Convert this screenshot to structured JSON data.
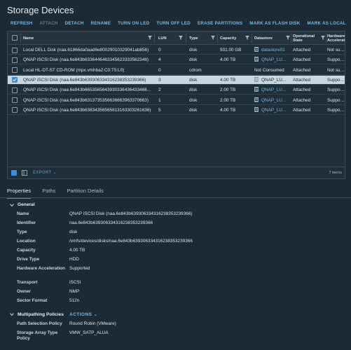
{
  "page": {
    "title": "Storage Devices"
  },
  "toolbar": {
    "refresh": "REFRESH",
    "attach": "ATTACH",
    "detach": "DETACH",
    "rename": "RENAME",
    "turn_on_led": "TURN ON LED",
    "turn_off_led": "TURN OFF LED",
    "erase_partitions": "ERASE PARTITIONS",
    "mark_flash": "MARK AS FLASH DISK",
    "mark_local": "MARK AS LOCAL",
    "more": "···"
  },
  "grid": {
    "columns": {
      "name": "Name",
      "lun": "LUN",
      "type": "Type",
      "capacity": "Capacity",
      "datastore": "Datastore",
      "operational_state": "Operational State",
      "hardware_acceleration": "Hardware Acceleration"
    },
    "rows": [
      {
        "name": "Local DELL Disk (naa.61866da0aad6e80029010329041ab856)",
        "lun": "0",
        "type": "disk",
        "capacity": "931.00 GB",
        "datastore": "datastore01",
        "ds_link": true,
        "state": "Attached",
        "hw": "Not suppor"
      },
      {
        "name": "QNAP iSCSI Disk (naa.6e843b6336446463345623333562346)",
        "lun": "4",
        "type": "disk",
        "capacity": "4.00 TB",
        "datastore": "QNAP_LU...",
        "ds_link": true,
        "state": "Attached",
        "hw": "Supported"
      },
      {
        "name": "Local HL-DT-ST CD-ROM (mpx.vmhba2:C0:T5:L0)",
        "lun": "0",
        "type": "cdrom",
        "capacity": "",
        "datastore": "Not Consumed",
        "ds_link": false,
        "state": "Attached",
        "hw": "Not suppor"
      },
      {
        "name": "QNAP iSCSI Disk (naa.6e843b639306334316238353239366)",
        "lun": "3",
        "type": "disk",
        "capacity": "4.00 TB",
        "datastore": "QNAP_LU...",
        "ds_link": true,
        "state": "Attached",
        "hw": "Supported",
        "selected": true
      },
      {
        "name": "QNAP iSCSI Disk (naa.6e843b6653565643930336436433466...",
        "lun": "2",
        "type": "disk",
        "capacity": "2.00 TB",
        "datastore": "QNAP_LU...",
        "ds_link": true,
        "state": "Attached",
        "hw": "Supported"
      },
      {
        "name": "QNAP iSCSI Disk (naa.6e843b6313735356636663963370663)",
        "lun": "1",
        "type": "disk",
        "capacity": "2.00 TB",
        "datastore": "QNAP_LU...",
        "ds_link": true,
        "state": "Attached",
        "hw": "Supported"
      },
      {
        "name": "QNAP iSCSI Disk (naa.6e843b63834356565613163303261636)",
        "lun": "5",
        "type": "disk",
        "capacity": "4.00 TB",
        "datastore": "QNAP_LU...",
        "ds_link": true,
        "state": "Attached",
        "hw": "Supported"
      }
    ],
    "export_label": "EXPORT",
    "items_count": "7 items"
  },
  "tabs": {
    "properties": "Properties",
    "paths": "Paths",
    "partition_details": "Partition Details"
  },
  "general": {
    "header": "General",
    "props": [
      {
        "label": "Name",
        "value": "QNAP iSCSI Disk (naa.6e843b639306334316238353239366)"
      },
      {
        "label": "Identifier",
        "value": "naa.6e843b639306334316238353239366"
      },
      {
        "label": "Type",
        "value": "disk"
      },
      {
        "label": "Location",
        "value": "/vmfs/devices/disks/naa.6e843b639306334316238353239366"
      },
      {
        "label": "Capacity",
        "value": "4.00 TB"
      },
      {
        "label": "Drive Type",
        "value": "HDD"
      },
      {
        "label": "Hardware Acceleration",
        "value": "Supported"
      },
      {
        "label": "Transport",
        "value": "iSCSI"
      },
      {
        "label": "Owner",
        "value": "NMP"
      },
      {
        "label": "Sector Format",
        "value": "512n"
      }
    ]
  },
  "multipathing": {
    "header": "Multipathing Policies",
    "actions_label": "ACTIONS",
    "props": [
      {
        "label": "Path Selection Policy",
        "value": "Round Robin (VMware)"
      },
      {
        "label": "Storage Array Type Policy",
        "value": "VMW_SATP_ALUA"
      }
    ]
  }
}
